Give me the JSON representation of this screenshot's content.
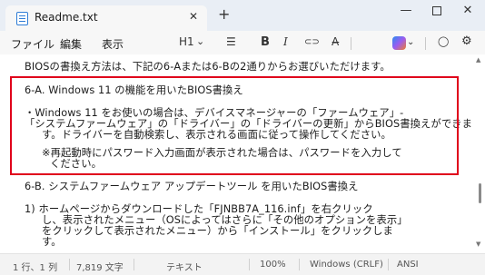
{
  "tab": {
    "title": "Readme.txt",
    "close": "✕",
    "new_tab": "+"
  },
  "window": {
    "minimize": "—",
    "close": "✕"
  },
  "menu": {
    "file": "ファイル",
    "edit": "編集",
    "view": "表示"
  },
  "toolbar": {
    "heading": "H1",
    "heading_caret": "⌄",
    "list": "☰",
    "bold": "B",
    "italic": "I",
    "link": "⊂⊃",
    "clear": "A̶",
    "settings": "⚙"
  },
  "editor": {
    "lines": [
      "BIOSの書換え方法は、下記の6-Aまたは6-Bの2通りからお選びいただけます。",
      "",
      "6-A. Windows 11 の機能を用いたBIOS書換え",
      "",
      "・Windows 11 をお使いの場合は、デバイスマネージャーの「ファームウェア」-",
      "「システムファームウェア」の「ドライバー」の「ドライバーの更新」からBIOS書換えができま",
      "す。ドライバーを自動検索し、表示される画面に従って操作してください。",
      "",
      "※再起動時にパスワード入力画面が表示された場合は、パスワードを入力して",
      "ください。",
      "",
      "6-B. システムファームウェア アップデートツール を用いたBIOS書換え",
      "",
      "1) ホームページからダウンロードした「FJNBB7A_116.inf」を右クリック",
      "し、表示されたメニュー（OSによってはさらに「その他のオプションを表示」",
      "をクリックして表示されたメニュー）から「インストール」をクリックしま",
      "す。"
    ]
  },
  "status": {
    "position": "1 行、1 列",
    "chars": "7,819 文字",
    "format": "テキスト",
    "zoom": "100%",
    "line_ending": "Windows (CRLF)",
    "encoding": "ANSI"
  }
}
